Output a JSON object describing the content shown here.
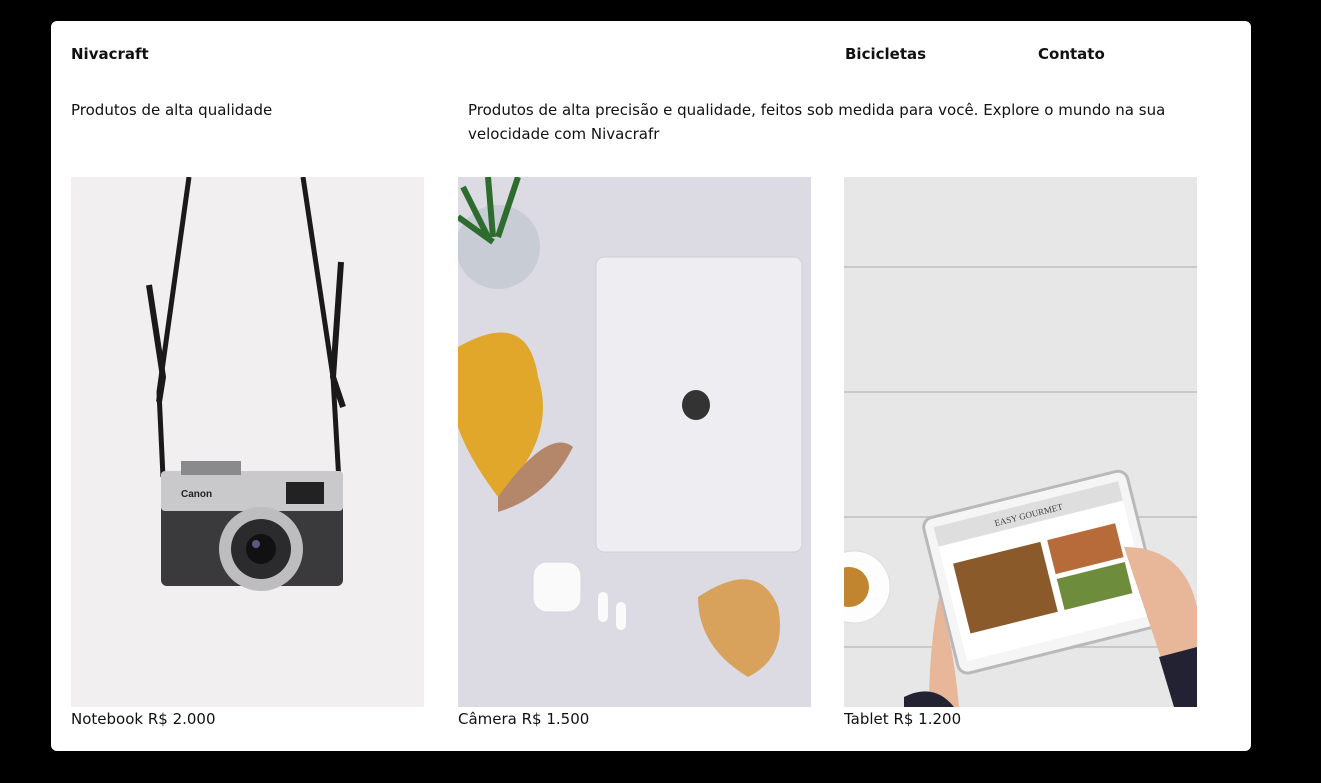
{
  "header": {
    "brand": "Nivacraft",
    "nav": [
      "Bicicletas",
      "Contato"
    ]
  },
  "intro": {
    "tagline": "Produtos de alta qualidade",
    "description": "Produtos de alta precisão e qualidade, feitos sob medida para você. Explore o mundo na sua velocidade com Nivacrafr"
  },
  "products": [
    {
      "caption": "Notebook R$ 2.000",
      "image": "camera-photo"
    },
    {
      "caption": "Câmera R$ 1.500",
      "image": "laptop-photo"
    },
    {
      "caption": "Tablet R$ 1.200",
      "image": "tablet-photo"
    }
  ],
  "tablet_screen": {
    "title": "EASY GOURMET"
  }
}
